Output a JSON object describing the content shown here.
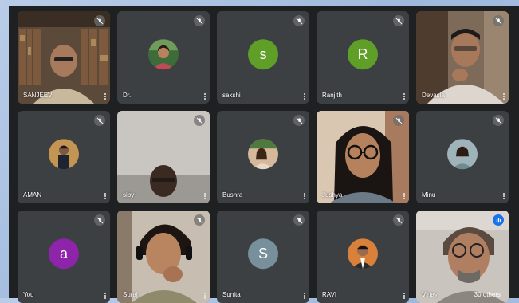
{
  "participants": [
    {
      "name": "SANJEEV",
      "kind": "video",
      "bg": "#6b5a46"
    },
    {
      "name": "Dr.",
      "kind": "photo",
      "bg": "#3d5a3a"
    },
    {
      "name": "sakshi",
      "kind": "letter",
      "letter": "s",
      "color": "#5f9e27"
    },
    {
      "name": "Ranjith",
      "kind": "letter",
      "letter": "R",
      "color": "#5f9e27"
    },
    {
      "name": "Devasia",
      "kind": "video",
      "bg": "#8a7a6a"
    },
    {
      "name": "AMAN",
      "kind": "photo",
      "bg": "#b88a4a"
    },
    {
      "name": "siby",
      "kind": "video",
      "bg": "#bdbdbd"
    },
    {
      "name": "Bushra",
      "kind": "photo",
      "bg": "#c9a58a"
    },
    {
      "name": "Jushya",
      "kind": "video",
      "bg": "#9a7a6a"
    },
    {
      "name": "Minu",
      "kind": "photo",
      "bg": "#8aa0a8"
    },
    {
      "name": "You",
      "kind": "letter",
      "letter": "a",
      "color": "#8e24aa"
    },
    {
      "name": "Suraj",
      "kind": "video",
      "bg": "#7a6555"
    },
    {
      "name": "Sunita",
      "kind": "letter",
      "letter": "S",
      "color": "#78909c"
    },
    {
      "name": "RAVI",
      "kind": "photo",
      "bg": "#c97b3a"
    },
    {
      "name": "Vinay",
      "kind": "video",
      "bg": "#b7b2ad",
      "others": "30 others"
    }
  ]
}
